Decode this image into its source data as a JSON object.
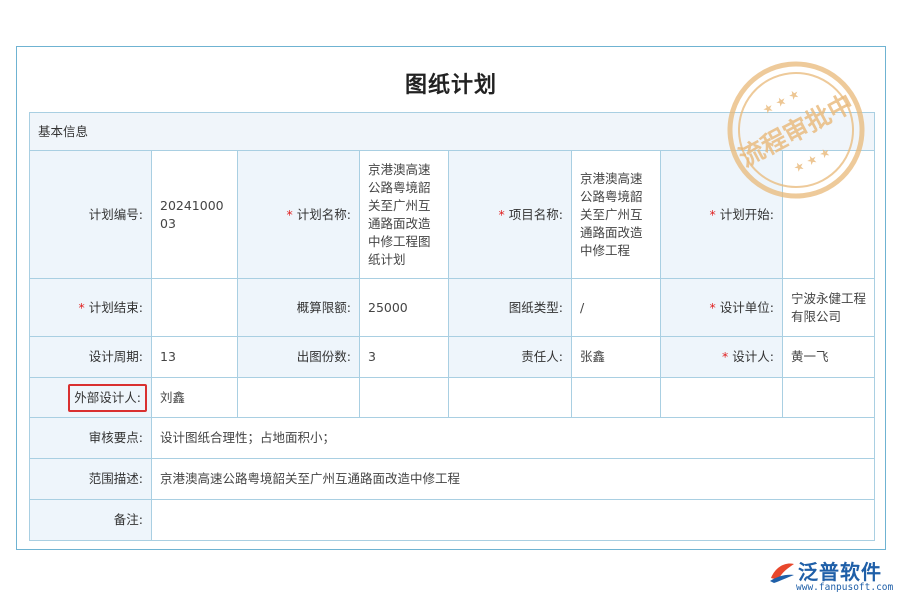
{
  "page_title": "图纸计划",
  "section_title": "基本信息",
  "stamp_text": "流程审批中",
  "rows": {
    "r1": {
      "plan_no_label": "计划编号:",
      "plan_no": "2024100003",
      "plan_name_label": "计划名称:",
      "plan_name": "京港澳高速公路粤境韶关至广州互通路面改造中修工程图纸计划",
      "project_name_label": "项目名称:",
      "project_name": "京港澳高速公路粤境韶关至广州互通路面改造中修工程",
      "plan_start_label": "计划开始:",
      "plan_start": ""
    },
    "r2": {
      "plan_end_label": "计划结束:",
      "plan_end": "",
      "budget_label": "概算限额:",
      "budget": "25000",
      "drawing_type_label": "图纸类型:",
      "drawing_type": "/",
      "design_unit_label": "设计单位:",
      "design_unit": "宁波永健工程有限公司"
    },
    "r3": {
      "cycle_label": "设计周期:",
      "cycle": "13",
      "copies_label": "出图份数:",
      "copies": "3",
      "owner_label": "责任人:",
      "owner": "张鑫",
      "designer_label": "设计人:",
      "designer": "黄一飞"
    },
    "r4": {
      "external_designer_label": "外部设计人:",
      "external_designer": "刘鑫"
    },
    "r5": {
      "review_label": "审核要点:",
      "review": "设计图纸合理性；占地面积小；"
    },
    "r6": {
      "scope_label": "范围描述:",
      "scope": "京港澳高速公路粤境韶关至广州互通路面改造中修工程"
    },
    "r7": {
      "remark_label": "备注:",
      "remark": ""
    }
  },
  "logo": {
    "name": "泛普软件",
    "url": "www.fanpusoft.com"
  },
  "colors": {
    "border": "#6fb3d2",
    "cell_border": "#a9cfe2",
    "label_bg": "#eef5fb",
    "required": "#e02020",
    "stamp": "#e8b878",
    "logo": "#1f5fa8"
  }
}
